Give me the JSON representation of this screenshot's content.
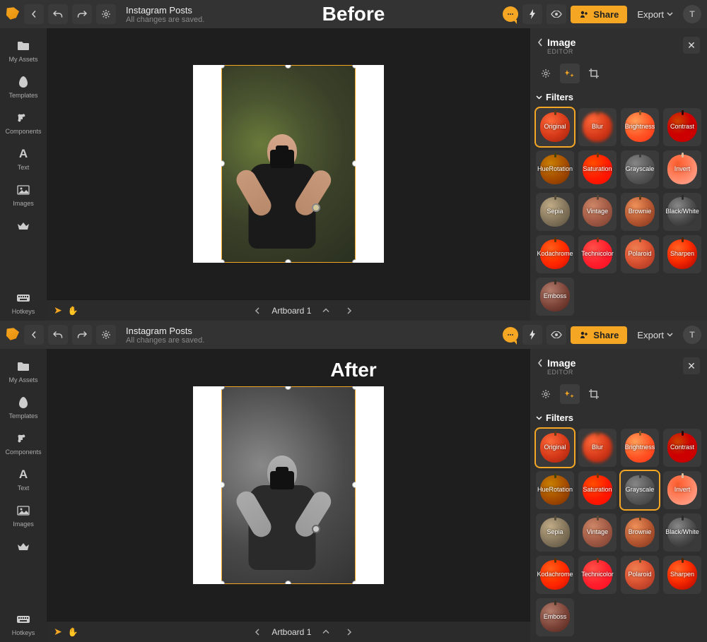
{
  "comparison": {
    "before_label": "Before",
    "after_label": "After"
  },
  "project": {
    "title": "Instagram Posts",
    "status": "All changes are saved."
  },
  "topbar": {
    "share": "Share",
    "export": "Export",
    "avatar_initial": "T"
  },
  "sidebar": {
    "my_assets": "My Assets",
    "templates": "Templates",
    "components": "Components",
    "text": "Text",
    "images": "Images",
    "hotkeys": "Hotkeys"
  },
  "canvas": {
    "artboard_label": "Artboard 1"
  },
  "panel": {
    "title": "Image",
    "subtitle": "EDITOR",
    "section": "Filters",
    "filters": {
      "original": "Original",
      "blur": "Blur",
      "brightness": "Brightness",
      "contrast": "Contrast",
      "hue": "HueRotation",
      "saturation": "Saturation",
      "grayscale": "Grayscale",
      "invert": "Invert",
      "sepia": "Sepia",
      "vintage": "Vintage",
      "brownie": "Brownie",
      "bw": "Black/White",
      "kodachrome": "Kodachrome",
      "technicolor": "Technicolor",
      "polaroid": "Polaroid",
      "sharpen": "Sharpen",
      "emboss": "Emboss"
    }
  },
  "selected_filter": {
    "before": "Original",
    "after": "Grayscale"
  }
}
